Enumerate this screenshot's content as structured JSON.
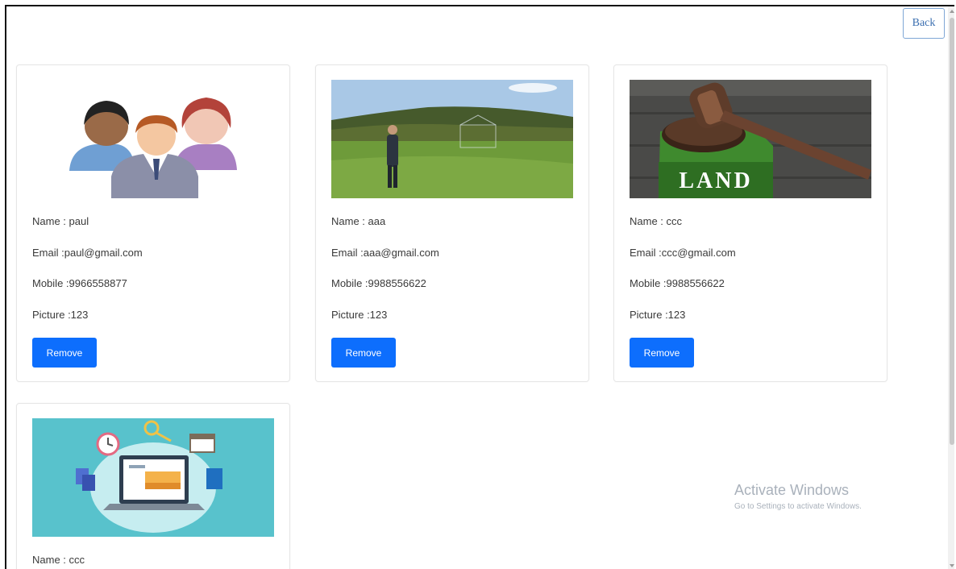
{
  "header": {
    "back_label": "Back"
  },
  "cards": [
    {
      "image": "people-group-illustration",
      "name": "Name : paul",
      "email": "Email :paul@gmail.com",
      "mobile": "Mobile :9966558877",
      "picture": "Picture :123",
      "remove_label": "Remove"
    },
    {
      "image": "field-landscape-photo",
      "name": "Name : aaa",
      "email": "Email :aaa@gmail.com",
      "mobile": "Mobile :9988556622",
      "picture": "Picture :123",
      "remove_label": "Remove"
    },
    {
      "image": "land-gavel-photo",
      "name": "Name : ccc",
      "email": "Email :ccc@gmail.com",
      "mobile": "Mobile :9988556622",
      "picture": "Picture :123",
      "remove_label": "Remove"
    },
    {
      "image": "laptop-workspace-illustration",
      "name": "Name : ccc"
    }
  ],
  "land_sign_text": "LAND",
  "watermark": {
    "title": "Activate Windows",
    "subtitle": "Go to Settings to activate Windows."
  },
  "colors": {
    "primary_button": "#0d6efd",
    "back_border": "#7fa7d6",
    "card_border": "#e6e6e6"
  }
}
